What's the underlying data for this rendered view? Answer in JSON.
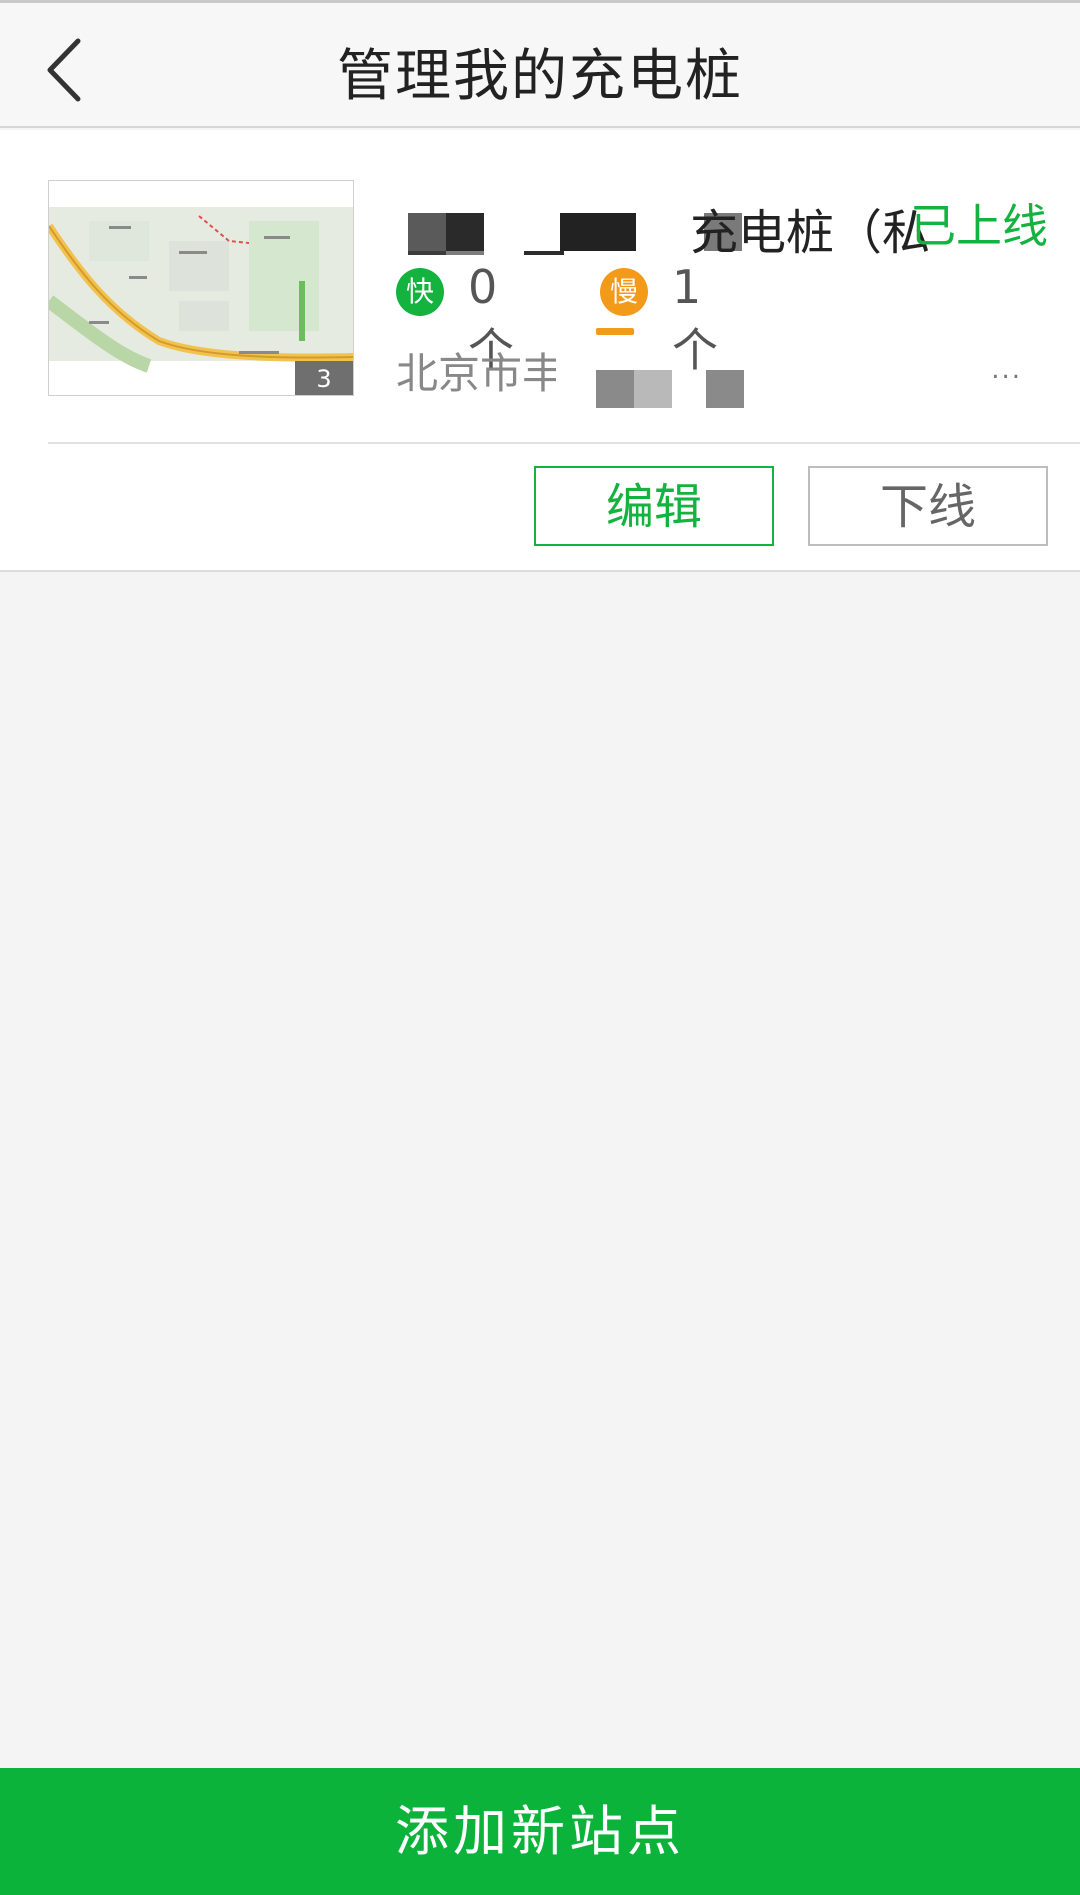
{
  "header": {
    "title": "管理我的充电桩",
    "back_icon": "chevron-left-icon"
  },
  "station": {
    "name_visible": "充电桩（私",
    "status": "已上线",
    "thumb_count": "3",
    "fast_label": "快",
    "fast_count": "0个",
    "slow_label": "慢",
    "slow_count": "1个",
    "address": "北京市丰",
    "ellipsis": "...",
    "edit_label": "编辑",
    "offline_label": "下线"
  },
  "footer": {
    "add_label": "添加新站点"
  },
  "colors": {
    "accent": "#14b23f",
    "bottom_bar": "#0bb33b",
    "slow": "#f39a1b"
  }
}
